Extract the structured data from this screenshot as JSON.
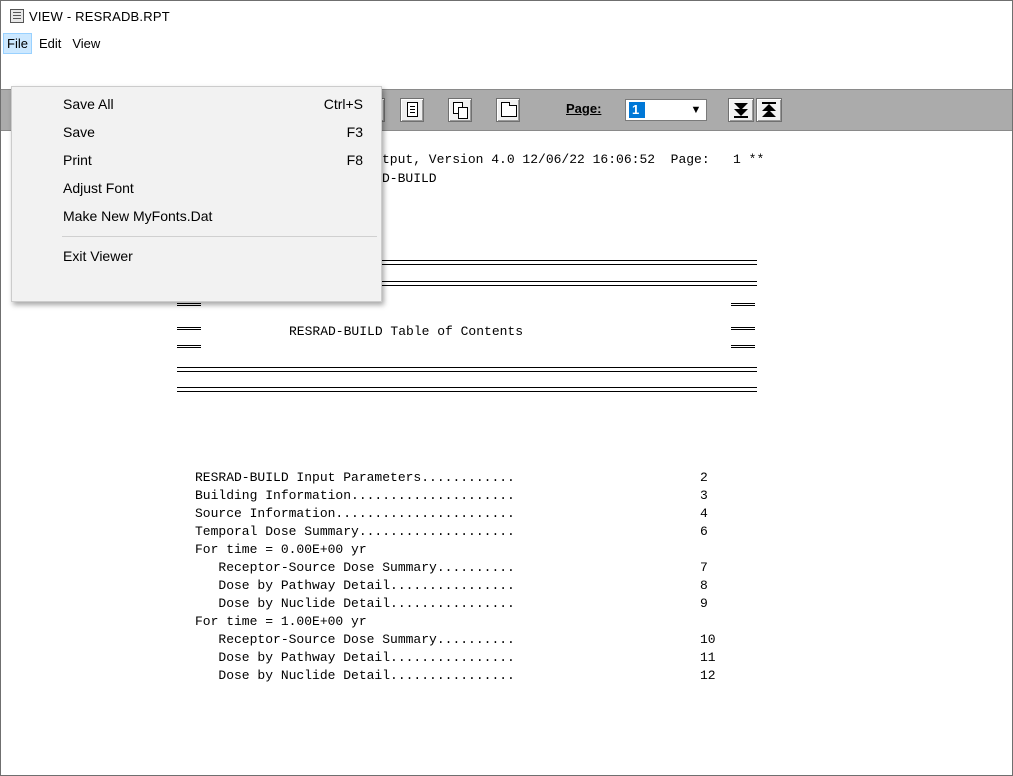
{
  "window": {
    "title": "VIEW - RESRADB.RPT",
    "icon": "report-viewer-icon"
  },
  "menubar": {
    "items": [
      "File",
      "Edit",
      "View"
    ],
    "active": "File"
  },
  "file_menu": {
    "items": [
      {
        "label": "Save All",
        "shortcut": "Ctrl+S"
      },
      {
        "label": "Save",
        "shortcut": "F3"
      },
      {
        "label": "Print",
        "shortcut": "F8"
      },
      {
        "label": "Adjust Font",
        "shortcut": ""
      },
      {
        "label": "Make New MyFonts.Dat",
        "shortcut": ""
      },
      {
        "label": "Exit Viewer",
        "shortcut": ""
      }
    ]
  },
  "toolbar": {
    "page_label": "Page:",
    "page_value": "1",
    "icons": [
      "document-icon",
      "copy-icon",
      "folder-icon",
      "next-page-icon",
      "previous-page-icon"
    ]
  },
  "report": {
    "header_line1": "tput, Version 4.0 12/06/22 16:06:52  Page:   1 **",
    "header_line2": "D-BUILD",
    "toc_title": "RESRAD-BUILD Table of Contents",
    "toc": [
      {
        "label": "RESRAD-BUILD Input Parameters............",
        "page": "2"
      },
      {
        "label": "Building Information.....................",
        "page": "3"
      },
      {
        "label": "Source Information.......................",
        "page": "4"
      },
      {
        "label": "Temporal Dose Summary....................",
        "page": "6"
      },
      {
        "label": "For time = 0.00E+00 yr",
        "page": ""
      },
      {
        "label": "   Receptor-Source Dose Summary..........",
        "page": "7"
      },
      {
        "label": "   Dose by Pathway Detail................",
        "page": "8"
      },
      {
        "label": "   Dose by Nuclide Detail................",
        "page": "9"
      },
      {
        "label": "For time = 1.00E+00 yr",
        "page": ""
      },
      {
        "label": "   Receptor-Source Dose Summary..........",
        "page": "10"
      },
      {
        "label": "   Dose by Pathway Detail................",
        "page": "11"
      },
      {
        "label": "   Dose by Nuclide Detail................",
        "page": "12"
      }
    ]
  }
}
